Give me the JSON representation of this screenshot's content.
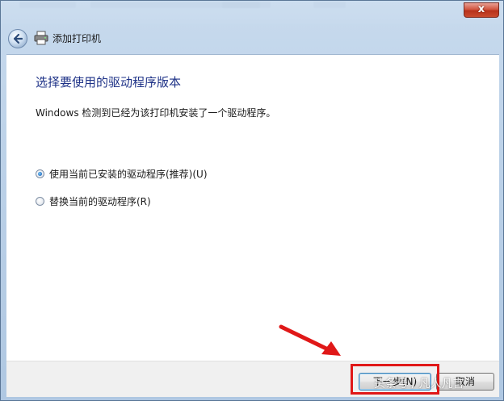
{
  "window": {
    "title": "添加打印机",
    "close_label": "x"
  },
  "page": {
    "heading": "选择要使用的驱动程序版本",
    "description": "Windows 检测到已经为该打印机安装了一个驱动程序。"
  },
  "options": [
    {
      "label": "使用当前已安装的驱动程序(推荐)(U)",
      "checked": true
    },
    {
      "label": "替换当前的驱动程序(R)",
      "checked": false
    }
  ],
  "buttons": {
    "next": "下一步(N)",
    "cancel": "取消"
  },
  "annotation": {
    "color": "#e01818",
    "watermark": "头条号 / 凡人凡言"
  },
  "icons": {
    "back": "back-arrow-icon",
    "printer": "printer-icon"
  }
}
